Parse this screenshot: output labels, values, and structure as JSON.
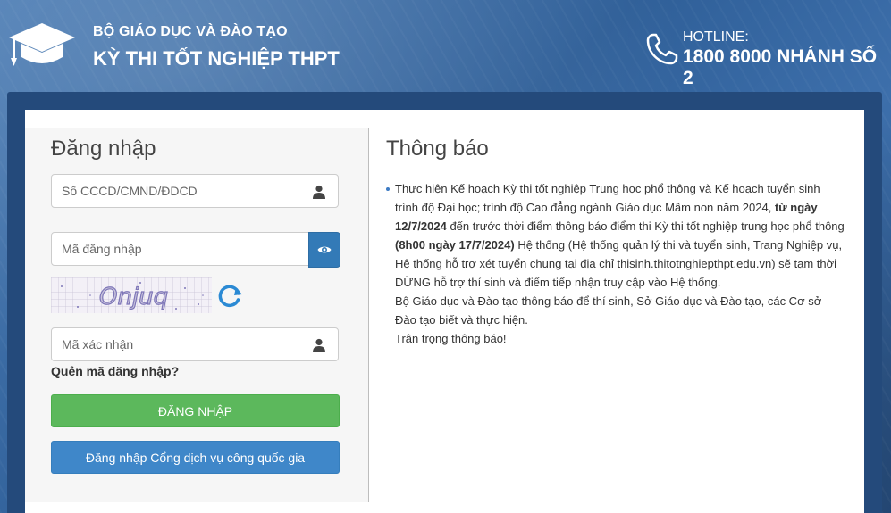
{
  "header": {
    "org": "BỘ GIÁO DỤC VÀ ĐÀO TẠO",
    "title": "KỲ THI TỐT NGHIỆP THPT",
    "hotline_label": "HOTLINE:",
    "hotline_number": "1800 8000 NHÁNH SỐ 2"
  },
  "login": {
    "title": "Đăng nhập",
    "id_placeholder": "Số CCCD/CMND/ĐDCD",
    "password_placeholder": "Mã đăng nhập",
    "captcha_placeholder": "Mã xác nhận",
    "captcha_text": "Onjuq",
    "forgot": "Quên mã đăng nhập?",
    "login_button": "ĐĂNG NHẬP",
    "national_portal_button": "Đăng nhập Cổng dịch vụ công quốc gia"
  },
  "notice": {
    "title": "Thông báo",
    "p1_a": "Thực hiện Kế hoạch Kỳ thi tốt nghiệp Trung học phổ thông và Kế hoạch tuyển sinh trình độ Đại học; trình độ Cao đẳng ngành Giáo dục Mầm non năm 2024, ",
    "p1_b": "từ ngày 12/7/2024",
    "p1_c": " đến trước thời điểm thông báo điểm thi Kỳ thi tốt nghiệp trung học phổ thông ",
    "p1_d": "(8h00 ngày 17/7/2024)",
    "p1_e": " Hệ thống (Hệ thống quản lý thi và tuyển sinh, Trang Nghiệp vụ, Hệ thống hỗ trợ xét tuyển chung tại địa chỉ thisinh.thitotnghiepthpt.edu.vn) sẽ tạm thời DỪNG hỗ trợ thí sinh và điểm tiếp nhận truy cập vào Hệ thống.",
    "p2": "Bộ Giáo dục và Đào tạo thông báo để thí sinh, Sở Giáo dục và Đào tạo, các Cơ sở Đào tạo biết và thực hiện.",
    "p3": "Trân trọng thông báo!"
  },
  "icons": {
    "logo": "graduation-cap-icon",
    "phone": "phone-icon",
    "user": "user-icon",
    "eye": "eye-icon",
    "refresh": "refresh-icon"
  },
  "colors": {
    "primary": "#337ab7",
    "success": "#5cb85c",
    "panel_border": "#244a7b"
  }
}
